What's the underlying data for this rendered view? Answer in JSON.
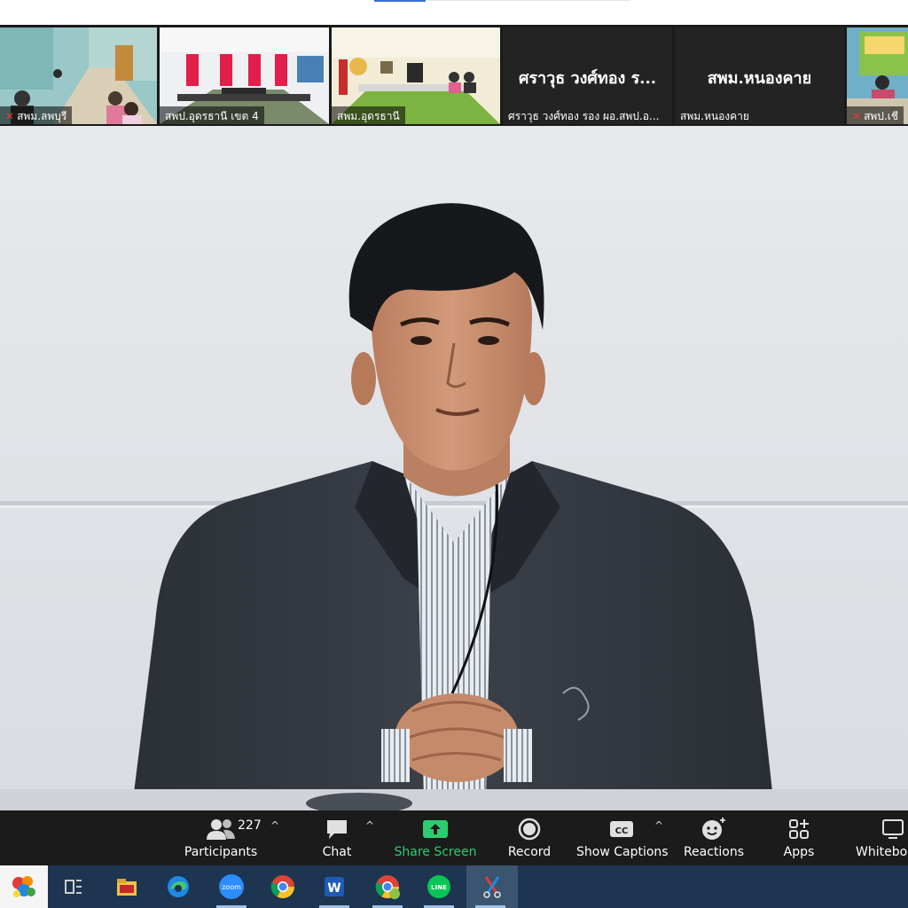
{
  "thumbnails": [
    {
      "label": "สพม.ลพบุรี",
      "muted": true
    },
    {
      "label": "สพป.อุดรธานี เขต  4",
      "muted": false
    },
    {
      "label": "สพม.อุดรธานี",
      "muted": false
    },
    {
      "label": "ศราวุธ วงศ์ทอง รอง ผอ.สพป.อ...",
      "display_name": "ศราวุธ วงศ์ทอง ร...",
      "muted": false
    },
    {
      "label": "สพม.หนองคาย",
      "display_name": "สพม.หนองคาย",
      "muted": false
    },
    {
      "label": "สพป.เชี",
      "muted": true
    }
  ],
  "toolbar": {
    "participants_label": "Participants",
    "participants_count": "227",
    "chat_label": "Chat",
    "share_label": "Share Screen",
    "record_label": "Record",
    "captions_label": "Show Captions",
    "reactions_label": "Reactions",
    "apps_label": "Apps",
    "whiteboard_label": "Whiteboa",
    "caret": "^"
  },
  "taskbar": {
    "icons": [
      "start-logo-icon",
      "task-view-icon",
      "file-explorer-icon",
      "edge-icon",
      "zoom-icon",
      "chrome-icon",
      "word-icon",
      "chrome-profile-icon",
      "line-icon",
      "snipping-tool-icon"
    ],
    "zoom_text": "zoom",
    "line_text": "LINE",
    "word_text": "W"
  },
  "colors": {
    "share_green": "#2ecc71",
    "mic_muted": "#e53935",
    "taskbar_bg": "#1d3550",
    "toolbar_bg": "#1b1b1b"
  }
}
